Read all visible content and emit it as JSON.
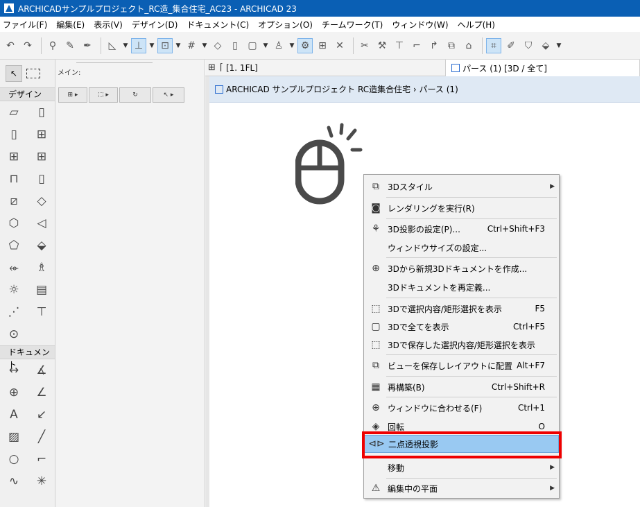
{
  "window": {
    "title": "ARCHICADサンプルプロジェクト_RC造_集合住宅_AC23 - ARCHICAD 23"
  },
  "menubar": {
    "items": [
      "ファイル(F)",
      "編集(E)",
      "表示(V)",
      "デザイン(D)",
      "ドキュメント(C)",
      "オプション(O)",
      "チームワーク(T)",
      "ウィンドウ(W)",
      "ヘルプ(H)"
    ]
  },
  "toolbox": {
    "design_label": "デザイン",
    "document_label": "ドキュメント"
  },
  "infobox": {
    "main_label": "メイン:"
  },
  "tabs": {
    "floor": "[1. 1FL]",
    "perspective": "パース (1) [3D / 全て]"
  },
  "viewer": {
    "path": "ARCHICAD サンプルプロジェクト RC造集合住宅 › パース (1)"
  },
  "context_menu": {
    "items": [
      {
        "label": "3Dスタイル",
        "shortcut": "",
        "submenu": true,
        "icon": "style-icon"
      },
      {
        "label": "レンダリングを実行(R)",
        "shortcut": "",
        "submenu": false,
        "icon": "camera-icon"
      },
      {
        "label": "3D投影の設定(P)...",
        "shortcut": "Ctrl+Shift+F3",
        "submenu": false,
        "icon": "projection-icon"
      },
      {
        "label": "ウィンドウサイズの設定...",
        "shortcut": "",
        "submenu": false,
        "icon": ""
      },
      {
        "label": "3Dから新規3Dドキュメントを作成...",
        "shortcut": "",
        "submenu": false,
        "icon": "new-document-icon"
      },
      {
        "label": "3Dドキュメントを再定義...",
        "shortcut": "",
        "submenu": false,
        "icon": ""
      },
      {
        "label": "3Dで選択内容/矩形選択を表示",
        "shortcut": "F5",
        "submenu": false,
        "icon": "cube-selection-icon"
      },
      {
        "label": "3Dで全てを表示",
        "shortcut": "Ctrl+F5",
        "submenu": false,
        "icon": "cube-icon"
      },
      {
        "label": "3Dで保存した選択内容/矩形選択を表示",
        "shortcut": "",
        "submenu": false,
        "icon": "cube-saved-icon"
      },
      {
        "label": "ビューを保存しレイアウトに配置",
        "shortcut": "Alt+F7",
        "submenu": false,
        "icon": "layout-icon"
      },
      {
        "label": "再構築(B)",
        "shortcut": "Ctrl+Shift+R",
        "submenu": false,
        "icon": "rebuild-icon"
      },
      {
        "label": "ウィンドウに合わせる(F)",
        "shortcut": "Ctrl+1",
        "submenu": false,
        "icon": "zoom-fit-icon"
      },
      {
        "label": "回転",
        "shortcut": "O",
        "submenu": false,
        "icon": "orbit-icon"
      },
      {
        "label": "二点透視投影",
        "shortcut": "",
        "submenu": false,
        "icon": "two-point-icon"
      },
      {
        "label": "移動",
        "shortcut": "",
        "submenu": true,
        "icon": ""
      },
      {
        "label": "編集中の平面",
        "shortcut": "",
        "submenu": true,
        "icon": "edit-plane-icon"
      }
    ],
    "highlighted_index": 13
  },
  "colors": {
    "titlebar": "#0a5fb4",
    "highlight": "#99c9f2",
    "annotation": "#ee0000"
  }
}
